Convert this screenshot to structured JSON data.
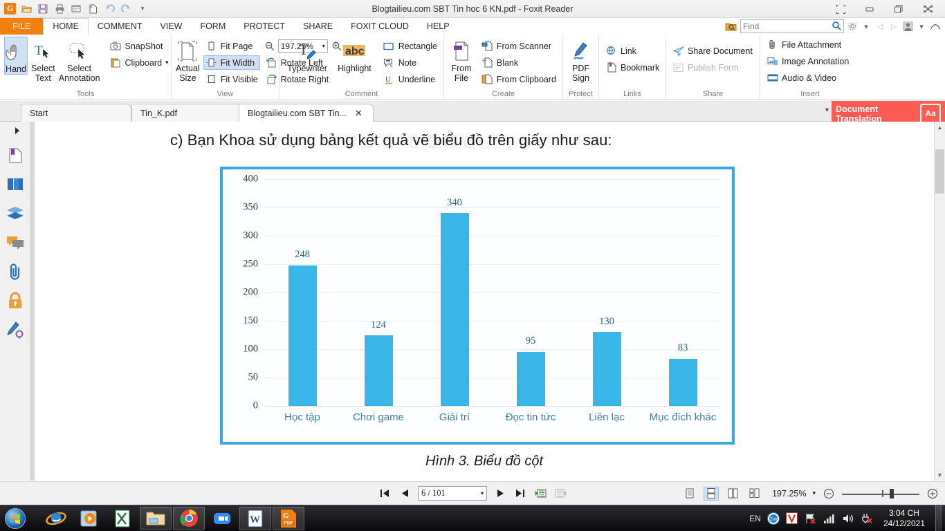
{
  "window": {
    "title": "Blogtailieu.com SBT Tin hoc 6 KN.pdf - Foxit Reader",
    "quick_access": [
      {
        "name": "foxit-logo-icon",
        "glyph": "G"
      },
      {
        "name": "open-icon",
        "glyph": "📂"
      },
      {
        "name": "save-icon",
        "glyph": "💾"
      },
      {
        "name": "print-icon",
        "glyph": "🖨"
      },
      {
        "name": "email-icon",
        "glyph": "✉"
      },
      {
        "name": "new-icon",
        "glyph": "✲"
      },
      {
        "name": "undo-icon",
        "glyph": "↶"
      },
      {
        "name": "redo-icon",
        "glyph": "↷"
      },
      {
        "name": "customize-qat-icon",
        "glyph": "▾"
      }
    ],
    "controls": [
      {
        "name": "fullscreen-button",
        "glyph": "⛶"
      },
      {
        "name": "minimize-button",
        "glyph": "–"
      },
      {
        "name": "restore-button",
        "glyph": "❐"
      },
      {
        "name": "close-button",
        "glyph": "✕"
      }
    ]
  },
  "menu": {
    "items": [
      "FILE",
      "HOME",
      "COMMENT",
      "VIEW",
      "FORM",
      "PROTECT",
      "SHARE",
      "FOXIT CLOUD",
      "HELP"
    ],
    "active": "HOME"
  },
  "search": {
    "placeholder": "Find",
    "search_icon": "search-icon",
    "folder_search_icon": "folder-search-icon",
    "settings_icon": "⚙",
    "dropdown_icon": "▾",
    "prev_icon": "◁",
    "next_icon": "▷",
    "account_icon": "👤",
    "cloud_icon": "☁"
  },
  "ribbon": {
    "groups": [
      {
        "label": "Tools",
        "big_buttons": [
          {
            "label": "Hand",
            "icon": "hand-icon",
            "glyph": "✋",
            "selected": true
          },
          {
            "label": "Select\nText",
            "icon": "select-text-icon",
            "glyph": "T",
            "selected": false
          },
          {
            "label": "Select\nAnnotation",
            "icon": "select-annotation-icon",
            "glyph": "↗",
            "selected": false
          }
        ],
        "small_items": [
          {
            "label": "SnapShot",
            "icon": "camera-icon",
            "glyph": "📷"
          },
          {
            "label": "Clipboard",
            "icon": "clipboard-icon",
            "glyph": "📋",
            "has_dropdown": true
          }
        ]
      },
      {
        "label": "View",
        "big_buttons": [
          {
            "label": "Actual\nSize",
            "icon": "actual-size-icon",
            "glyph": "📄",
            "selected": false
          }
        ],
        "small_items": [
          {
            "label": "Fit Page",
            "icon": "fit-page-icon",
            "glyph": "⬚"
          },
          {
            "label": "Fit Width",
            "icon": "fit-width-icon",
            "glyph": "⬌",
            "selected": true
          },
          {
            "label": "Fit Visible",
            "icon": "fit-visible-icon",
            "glyph": "⬜"
          }
        ],
        "zoom": {
          "value": "197.25%",
          "zoom_out_icon": "zoom-out-icon",
          "zoom_in_icon": "zoom-in-icon",
          "dropdown_icon": "▾"
        },
        "rotate": [
          {
            "label": "Rotate Left",
            "icon": "rotate-left-icon"
          },
          {
            "label": "Rotate Right",
            "icon": "rotate-right-icon"
          }
        ]
      },
      {
        "label": "Comment",
        "big_buttons": [
          {
            "label": "Typewriter",
            "icon": "typewriter-icon",
            "glyph": "T",
            "selected": false
          },
          {
            "label": "Highlight",
            "icon": "highlight-icon",
            "glyph": "abc",
            "selected": false
          }
        ],
        "small_items": [
          {
            "label": "Rectangle",
            "icon": "rectangle-icon",
            "glyph": "▭"
          },
          {
            "label": "Note",
            "icon": "note-icon",
            "glyph": "🗒"
          },
          {
            "label": "Underline",
            "icon": "underline-icon",
            "glyph": "U"
          }
        ]
      },
      {
        "label": "Create",
        "big_buttons": [
          {
            "label": "From\nFile",
            "icon": "from-file-icon",
            "glyph": "📄",
            "selected": false
          }
        ],
        "small_items": [
          {
            "label": "From Scanner",
            "icon": "scanner-icon",
            "glyph": "🖨"
          },
          {
            "label": "Blank",
            "icon": "blank-page-icon",
            "glyph": "✳"
          },
          {
            "label": "From Clipboard",
            "icon": "from-clipboard-icon",
            "glyph": "📋"
          }
        ]
      },
      {
        "label": "Protect",
        "big_buttons": [
          {
            "label": "PDF\nSign",
            "icon": "pdf-sign-icon",
            "glyph": "✎",
            "selected": false
          }
        ],
        "small_items": []
      },
      {
        "label": "Links",
        "big_buttons": [],
        "small_items": [
          {
            "label": "Link",
            "icon": "link-globe-icon",
            "glyph": "🌐"
          },
          {
            "label": "Bookmark",
            "icon": "bookmark-icon",
            "glyph": "🔖"
          }
        ]
      },
      {
        "label": "Share",
        "big_buttons": [],
        "small_items": [
          {
            "label": "Share Document",
            "icon": "share-document-icon",
            "glyph": "➤"
          },
          {
            "label": "Publish Form",
            "icon": "publish-form-icon",
            "glyph": "▤",
            "disabled": true
          }
        ]
      },
      {
        "label": "Insert",
        "big_buttons": [],
        "small_items": [
          {
            "label": "File Attachment",
            "icon": "file-attachment-icon",
            "glyph": "📎"
          },
          {
            "label": "Image Annotation",
            "icon": "image-annotation-icon",
            "glyph": "🖼"
          },
          {
            "label": "Audio & Video",
            "icon": "audio-video-icon",
            "glyph": "🎬"
          }
        ]
      }
    ]
  },
  "tabs": {
    "items": [
      {
        "label": "Start",
        "active": false,
        "closable": false
      },
      {
        "label": "Tin_K.pdf",
        "active": false,
        "closable": false
      },
      {
        "label": "Blogtailieu.com SBT Tin...",
        "active": true,
        "closable": true,
        "close_glyph": "✕"
      }
    ],
    "collapse_icon": "▾",
    "document_translation": {
      "line1": "Document",
      "line2": "Translation",
      "icon": "translate-aa-icon",
      "icon_text": "Aa",
      "color": "#fc5c52"
    }
  },
  "left_nav": {
    "items": [
      {
        "name": "expand-panel-icon",
        "glyph": "▸"
      },
      {
        "name": "bookmark-panel-icon",
        "glyph": "🔖"
      },
      {
        "name": "pages-panel-icon",
        "glyph": "❐"
      },
      {
        "name": "layers-panel-icon",
        "glyph": "⬦"
      },
      {
        "name": "comments-panel-icon",
        "glyph": "💬"
      },
      {
        "name": "attachments-panel-icon",
        "glyph": "📎"
      },
      {
        "name": "security-panel-icon",
        "glyph": "🔒"
      },
      {
        "name": "signatures-panel-icon",
        "glyph": "✎"
      }
    ]
  },
  "document": {
    "question_text": "c) Bạn Khoa sử dụng bảng kết quả vẽ biểu đồ trên giấy như sau:",
    "watermark": "VỚI CUỘC SỐNG",
    "caption": "Hình 3. Biểu đồ cột"
  },
  "chart_data": {
    "type": "bar",
    "title": "Hình 3. Biểu đồ cột",
    "categories": [
      "Học tập",
      "Chơi game",
      "Giải trí",
      "Đọc tin tức",
      "Liên lạc",
      "Mục đích khác"
    ],
    "values": [
      248,
      124,
      340,
      95,
      130,
      83
    ],
    "data_labels": [
      "248",
      "124",
      "340",
      "95",
      "130",
      "83"
    ],
    "yticks": [
      0,
      50,
      100,
      150,
      200,
      250,
      300,
      350,
      400
    ],
    "ytick_labels": [
      "0",
      "50",
      "100",
      "150",
      "200",
      "250",
      "300",
      "350",
      "400"
    ],
    "ylim": [
      0,
      400
    ],
    "xlabel": "",
    "ylabel": "",
    "grid": true,
    "legend": false,
    "bar_color": "#39b5e8",
    "label_color": "#2d617a",
    "axis_label_color": "#3f7f9e",
    "border_color": "#35a9e0"
  },
  "status_bar": {
    "first_page_icon": "⏮",
    "prev_page_icon": "◀",
    "page_value": "6 / 101",
    "page_dropdown_icon": "▾",
    "next_page_icon": "▶",
    "last_page_icon": "⏭",
    "prev_view_icon": "prev-view-icon",
    "next_view_icon": "next-view-icon",
    "view_modes": [
      {
        "name": "single-page-view",
        "selected": false
      },
      {
        "name": "continuous-view",
        "selected": true
      },
      {
        "name": "facing-view",
        "selected": false
      },
      {
        "name": "continuous-facing-view",
        "selected": false
      }
    ],
    "zoom_value": "197.25%",
    "zoom_dropdown_icon": "▾",
    "zoom_out_icon": "⊖",
    "zoom_in_icon": "⊕"
  },
  "taskbar": {
    "start_label": "Start",
    "apps": [
      {
        "name": "internet-explorer-icon",
        "glyph": "e",
        "open": false
      },
      {
        "name": "media-player-icon",
        "glyph": "▶",
        "open": false
      },
      {
        "name": "excel-icon",
        "glyph": "X",
        "open": false
      },
      {
        "name": "file-explorer-icon",
        "glyph": "📁",
        "open": true
      },
      {
        "name": "chrome-icon",
        "glyph": "●",
        "open": true
      },
      {
        "name": "zoom-app-icon",
        "glyph": "📹",
        "open": false
      },
      {
        "name": "word-icon",
        "glyph": "W",
        "open": true
      },
      {
        "name": "foxit-reader-icon",
        "glyph": "PDF",
        "open": true
      }
    ],
    "tray": {
      "language": "EN",
      "icons": [
        {
          "name": "zalo-icon",
          "glyph": "Z"
        },
        {
          "name": "unikey-icon",
          "glyph": "V"
        },
        {
          "name": "action-center-icon",
          "glyph": "🏳"
        },
        {
          "name": "network-icon",
          "glyph": "▃"
        },
        {
          "name": "volume-icon",
          "glyph": "🔊"
        },
        {
          "name": "safely-remove-icon",
          "glyph": "🔌"
        }
      ],
      "time": "3:04 CH",
      "date": "24/12/2021"
    }
  }
}
